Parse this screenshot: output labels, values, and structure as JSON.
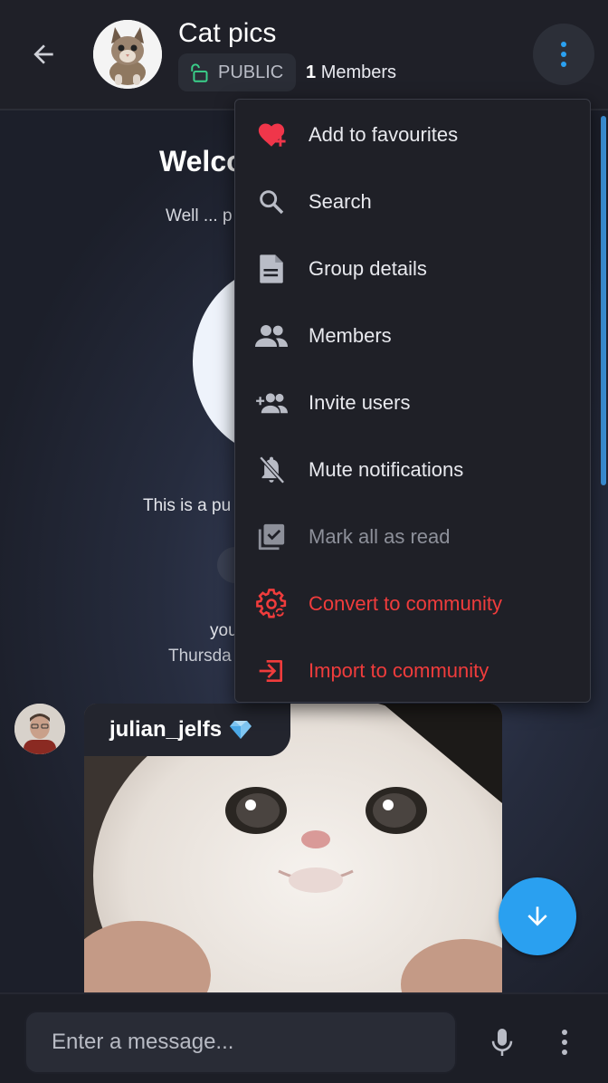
{
  "header": {
    "title": "Cat pics",
    "visibility": "PUBLIC",
    "members_number": "1",
    "members_label": "Members"
  },
  "menu": {
    "items": [
      {
        "label": "Add to favourites",
        "icon": "heart-plus-icon"
      },
      {
        "label": "Search",
        "icon": "search-icon"
      },
      {
        "label": "Group details",
        "icon": "document-icon"
      },
      {
        "label": "Members",
        "icon": "people-icon"
      },
      {
        "label": "Invite users",
        "icon": "add-users-icon"
      },
      {
        "label": "Mute notifications",
        "icon": "bell-off-icon"
      },
      {
        "label": "Mark all as read",
        "icon": "checklist-icon",
        "disabled": true
      },
      {
        "label": "Convert to community",
        "icon": "gear-convert-icon",
        "danger": true
      },
      {
        "label": "Import to community",
        "icon": "import-icon",
        "danger": true
      }
    ]
  },
  "chat": {
    "welcome_title": "Welco",
    "welcome_sub": "Well ... p",
    "public_note": "This is a pu",
    "event_user": "you",
    "event_time": "Thursda",
    "message": {
      "sender": "julian_jelfs",
      "badge": "diamond-icon"
    }
  },
  "footer": {
    "placeholder": "Enter a message..."
  },
  "colors": {
    "accent": "#2aa0f0",
    "danger": "#f03c3c",
    "heart": "#f0364a",
    "public_lock": "#3ad08a"
  }
}
